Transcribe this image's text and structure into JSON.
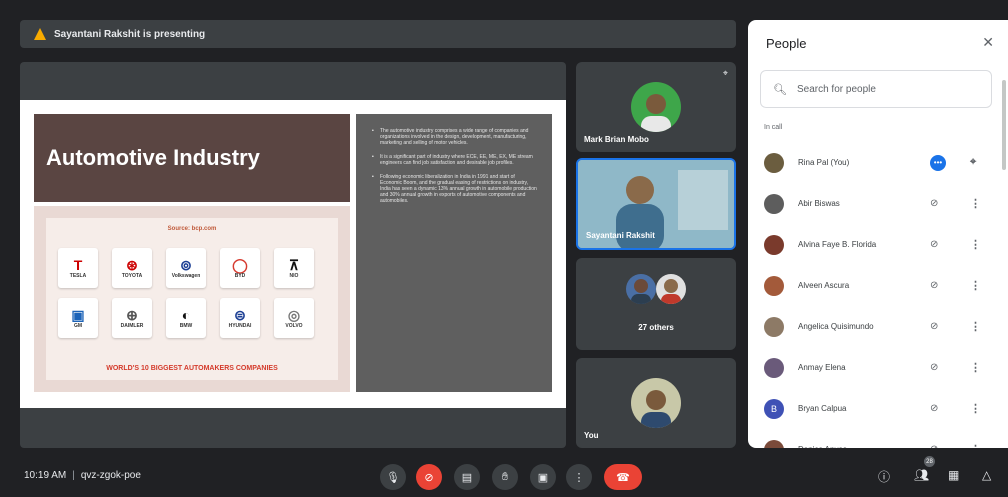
{
  "presenting_bar": {
    "text": "Sayantani Rakshit is presenting"
  },
  "slide": {
    "title": "Automotive Industry",
    "logo_source": "Source: bcp.com",
    "logos": [
      {
        "mark": "T",
        "label": "TESLA",
        "color": "#cc0000"
      },
      {
        "mark": "⊛",
        "label": "TOYOTA",
        "color": "#cc0000"
      },
      {
        "mark": "⊚",
        "label": "Volkswagen",
        "color": "#1c3f94"
      },
      {
        "mark": "◯",
        "label": "BYD",
        "color": "#d63a2f"
      },
      {
        "mark": "⊼",
        "label": "NIO",
        "color": "#111111"
      },
      {
        "mark": "▣",
        "label": "GM",
        "color": "#1c63b8"
      },
      {
        "mark": "⊕",
        "label": "DAIMLER",
        "color": "#555555"
      },
      {
        "mark": "◐",
        "label": "BMW",
        "color": "#111111"
      },
      {
        "mark": "⊜",
        "label": "HYUNDAI",
        "color": "#1c3f94"
      },
      {
        "mark": "◎",
        "label": "VOLVO",
        "color": "#777777"
      }
    ],
    "logo_footer": "WORLD'S 10 BIGGEST AUTOMAKERS COMPANIES",
    "bullets": [
      "The automotive industry comprises a wide range of companies and organizations involved in the design, development, manufacturing, marketing and selling of motor vehicles.",
      "It is a significant part of industry where ECE, EE, ME, EX, ME stream engineers can find job satisfaction and desirable job profiles.",
      "Following economic liberalization in India in 1991 and start of Economic Boom, and the gradual easing of restrictions on industry, India has seen a dynamic 13% annual growth in automobile production and 30% annual growth in exports of automotive components and automobiles."
    ]
  },
  "tiles": [
    {
      "name": "Mark Brian Mobo",
      "skin": "#7a5a3c",
      "bg": "#3ea64a"
    },
    {
      "name": "Sayantani Rakshit",
      "skin": "#8a6a4a",
      "bg": "#8fb8c8"
    },
    {
      "name": "27 others"
    },
    {
      "name": "You",
      "skin": "#7a5a3c",
      "bg": "#c8c8a8"
    }
  ],
  "people_panel": {
    "title": "People",
    "close_icon": "close-icon",
    "search_placeholder": "Search for people",
    "section_label": "In call",
    "people": [
      {
        "name": "Rina Pal (You)",
        "avatar": "#6b5d3f",
        "self": true
      },
      {
        "name": "Abir Biswas",
        "avatar": "#5d5d5d"
      },
      {
        "name": "Alvina Faye B. Florida",
        "avatar": "#7a3a2c"
      },
      {
        "name": "Alveen Ascura",
        "avatar": "#a35a3a"
      },
      {
        "name": "Angelica Quisimundo",
        "avatar": "#8d7a66"
      },
      {
        "name": "Anmay Elena",
        "avatar": "#6a5a7a"
      },
      {
        "name": "Bryan Calpua",
        "avatar": "#3f51b5",
        "initial": "B"
      },
      {
        "name": "Danica Anyas",
        "avatar": "#7a4a3a"
      }
    ]
  },
  "bottom_bar": {
    "time": "10:19 AM",
    "meeting_code": "qvz-zgok-poe",
    "participant_count": "28"
  },
  "colors": {
    "background": "#202124",
    "accent_blue": "#1a73e8",
    "danger_red": "#ea4335"
  }
}
